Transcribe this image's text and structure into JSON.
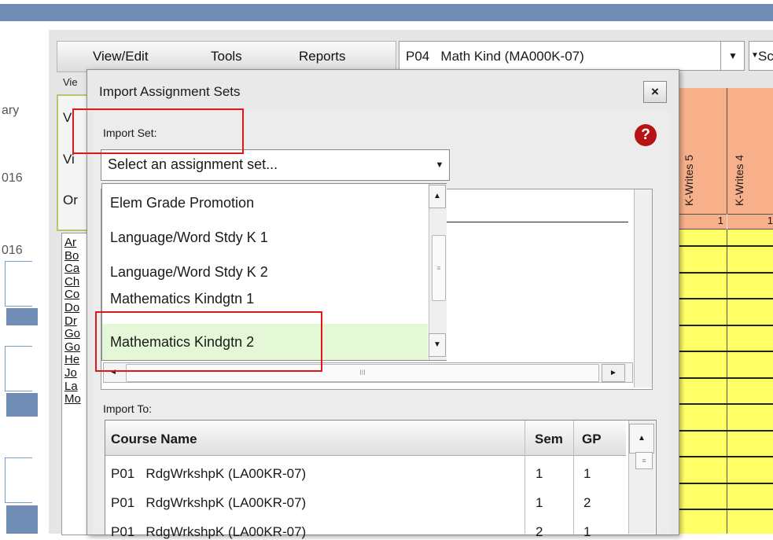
{
  "menu": {
    "view_edit": "View/Edit",
    "tools": "Tools",
    "reports": "Reports"
  },
  "course_select": {
    "value": "P04   Math Kind (MA000K-07)",
    "second_value": "Sc"
  },
  "left_fragments": {
    "line1": "ary",
    "line2": "016",
    "line3": "016"
  },
  "behind": {
    "tab_label": "Vie",
    "rows": [
      "Vi",
      "Vi",
      "Or"
    ],
    "list": [
      "Ar",
      "Bo",
      "Ca",
      "Ch",
      "Co",
      "Do",
      "Dr",
      "Go",
      "Go",
      "He",
      "Jo",
      "La",
      "Mo"
    ]
  },
  "grid": {
    "headers": [
      "K-Writes 5",
      "K-Writes 4"
    ],
    "counts": [
      "1",
      "1"
    ],
    "colors": {
      "header": "#f8b08a",
      "cell": "#ffff66"
    }
  },
  "dialog": {
    "title": "Import Assignment Sets",
    "close_glyph": "×",
    "help_glyph": "?",
    "import_set_label": "Import Set:",
    "import_set_value": "Select an assignment set...",
    "dropdown_options": [
      "Elem Grade Promotion",
      "Language/Word Stdy K 1",
      "Language/Word Stdy K 2",
      "Mathematics Kindgtn 1",
      "Mathematics Kindgtn 2"
    ],
    "selected_option": "Mathematics Kindgtn 2",
    "import_to_label": "Import To:",
    "table": {
      "columns": [
        "Course Name",
        "Sem",
        "GP"
      ],
      "rows": [
        [
          "P01   RdgWrkshpK (LA00KR-07)",
          "1",
          "1"
        ],
        [
          "P01   RdgWrkshpK (LA00KR-07)",
          "1",
          "2"
        ],
        [
          "P01   RdgWrkshpK (LA00KR-07)",
          "2",
          "1"
        ]
      ]
    }
  },
  "icons": {
    "dropdown": "chevron-down-icon",
    "up": "chevron-up-icon",
    "left": "chevron-left-icon",
    "right": "chevron-right-icon",
    "grip": "scroll-grip-icon",
    "help": "help-icon",
    "close": "close-icon"
  },
  "glyphs": {
    "down": "▼",
    "up": "▲",
    "left": "◄",
    "right": "►",
    "grip_h": "III",
    "grip_v": "≡"
  },
  "accent": {
    "annotation": "#e01717",
    "help": "#b81313",
    "selected": "#e4f7d6",
    "header_strip": "#6f8db5"
  }
}
